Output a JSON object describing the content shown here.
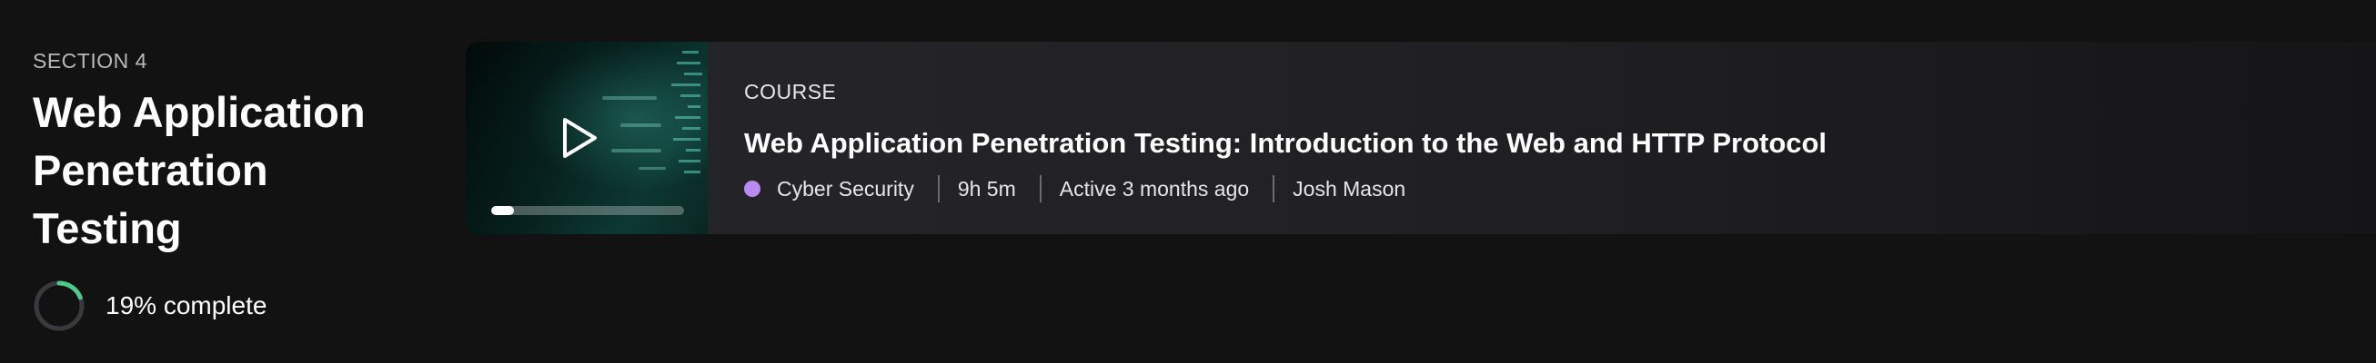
{
  "section": {
    "label": "SECTION 4",
    "title_lines": [
      "Web Application",
      "Penetration",
      "Testing"
    ],
    "progress_percent": 19,
    "progress_text": "19% complete",
    "progress_color": "#4fc98a"
  },
  "course": {
    "type_label": "COURSE",
    "title": "Web Application Penetration Testing: Introduction to the Web and HTTP Protocol",
    "category": "Cyber Security",
    "category_color": "#b98af2",
    "duration": "9h 5m",
    "activity": "Active 3 months ago",
    "author": "Josh Mason",
    "play_icon": "play-icon",
    "video_progress_fraction": 0.12
  }
}
